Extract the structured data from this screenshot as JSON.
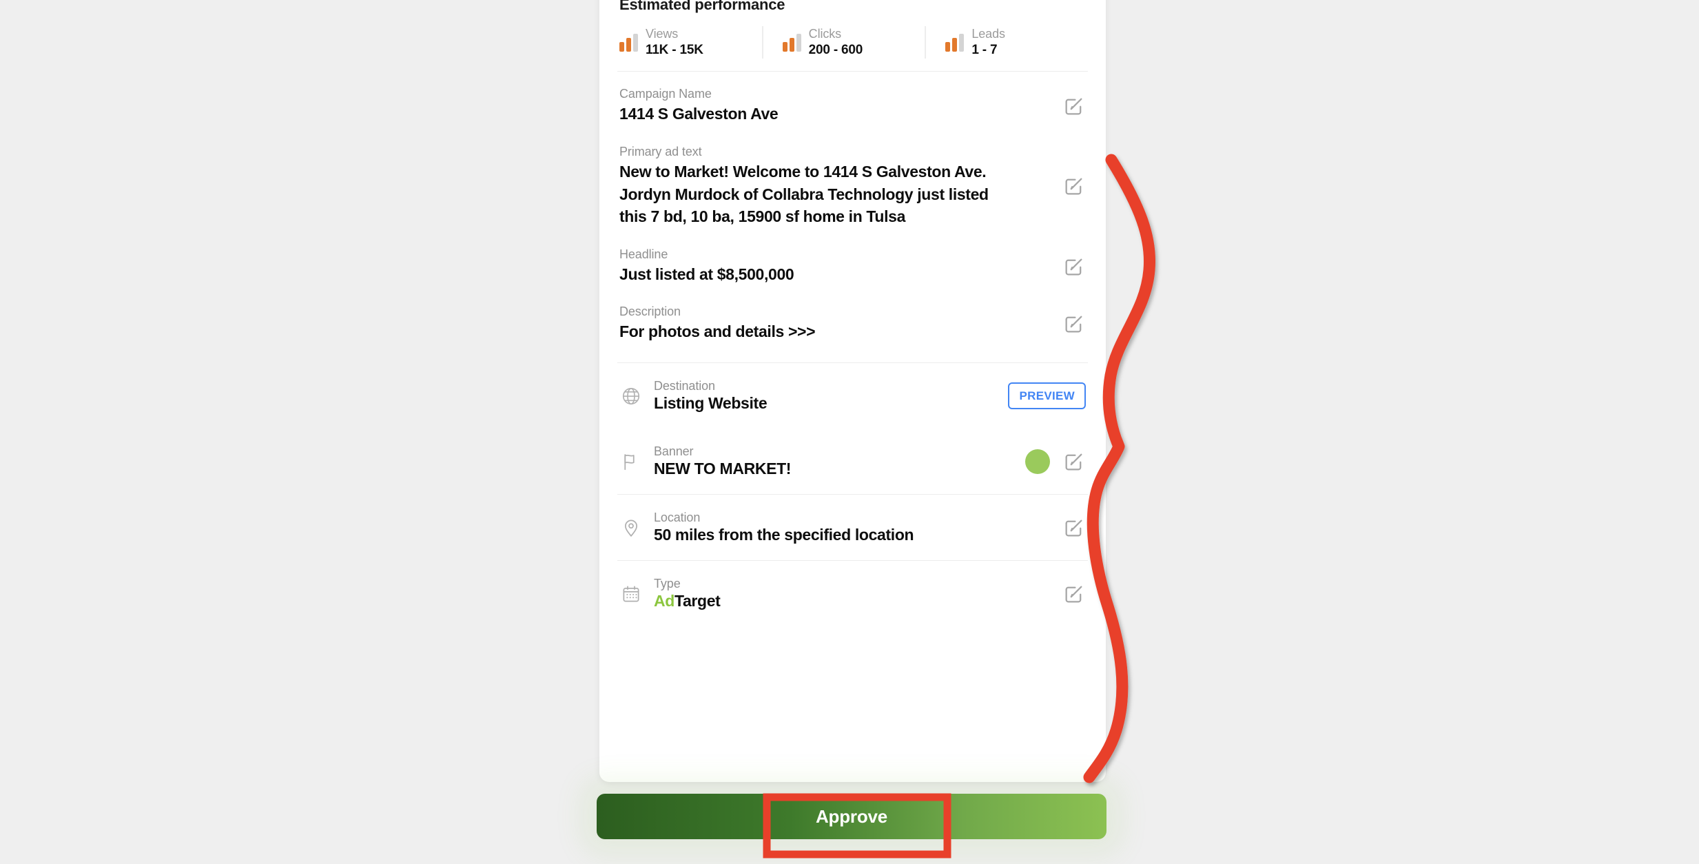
{
  "card": {
    "performance": {
      "title": "Estimated performance",
      "metrics": [
        {
          "label": "Views",
          "value": "11K - 15K",
          "icon": "bar-chart-icon"
        },
        {
          "label": "Clicks",
          "value": "200 - 600",
          "icon": "bar-chart-icon"
        },
        {
          "label": "Leads",
          "value": "1 - 7",
          "icon": "bar-chart-icon"
        }
      ]
    },
    "fields": [
      {
        "label": "Campaign Name",
        "value": "1414 S Galveston Ave",
        "edit_icon": "edit-icon"
      },
      {
        "label": "Primary ad text",
        "value": "New to Market! Welcome to 1414 S Galveston Ave. Jordyn Murdock of Collabra Technology just listed this 7 bd, 10 ba, 15900 sf home in Tulsa",
        "edit_icon": "edit-icon"
      },
      {
        "label": "Headline",
        "value": "Just listed at $8,500,000",
        "edit_icon": "edit-icon"
      },
      {
        "label": "Description",
        "value": "For photos and details >>>",
        "edit_icon": "edit-icon"
      }
    ],
    "rows": {
      "destination": {
        "icon": "globe-icon",
        "label": "Destination",
        "value": "Listing Website",
        "preview_label": "PREVIEW"
      },
      "banner": {
        "icon": "flag-icon",
        "label": "Banner",
        "value": "NEW TO MARKET!",
        "swatch_color": "#9aca5c",
        "edit_icon": "edit-icon"
      },
      "location": {
        "icon": "location-pin-icon",
        "label": "Location",
        "value": "50 miles from the specified location",
        "edit_icon": "edit-icon"
      },
      "type": {
        "icon": "calendar-icon",
        "label": "Type",
        "value_prefix": "Ad",
        "value_suffix": "Target",
        "prefix_color": "#8cc63f",
        "edit_icon": "edit-icon"
      }
    }
  },
  "approve_button": {
    "label": "Approve"
  },
  "annotation": {
    "color": "#e8402a",
    "shapes": [
      "wavy-bracket-stroke",
      "highlight-rectangle"
    ]
  }
}
